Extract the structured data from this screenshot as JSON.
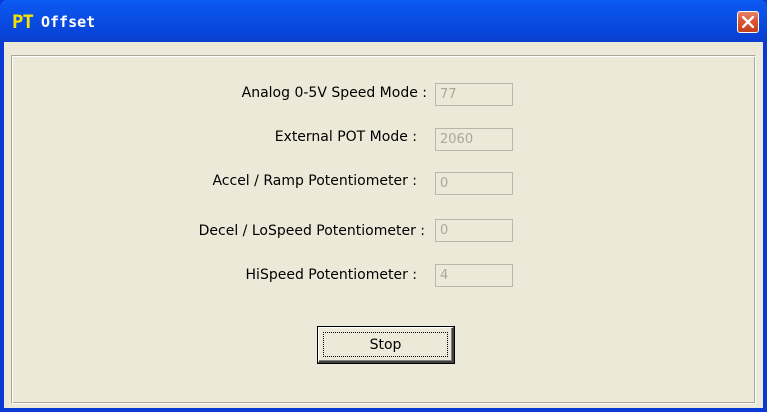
{
  "window": {
    "icon_text": "PT",
    "title": "Offset"
  },
  "fields": [
    {
      "label": "Analog 0-5V Speed Mode :",
      "value": "77"
    },
    {
      "label": "External POT Mode :",
      "value": "2060"
    },
    {
      "label": "Accel / Ramp Potentiometer :",
      "value": "0"
    },
    {
      "label": "Decel / LoSpeed Potentiometer :",
      "value": "0"
    },
    {
      "label": "HiSpeed Potentiometer :",
      "value": "4"
    }
  ],
  "actions": {
    "stop_label": "Stop"
  },
  "icons": {
    "close": "close-icon",
    "app": "pt-app-icon"
  },
  "colors": {
    "title_bar": "#0a4fe6",
    "client_bg": "#ece9d8",
    "close_button": "#d9532e",
    "disabled_text": "#aca899"
  }
}
